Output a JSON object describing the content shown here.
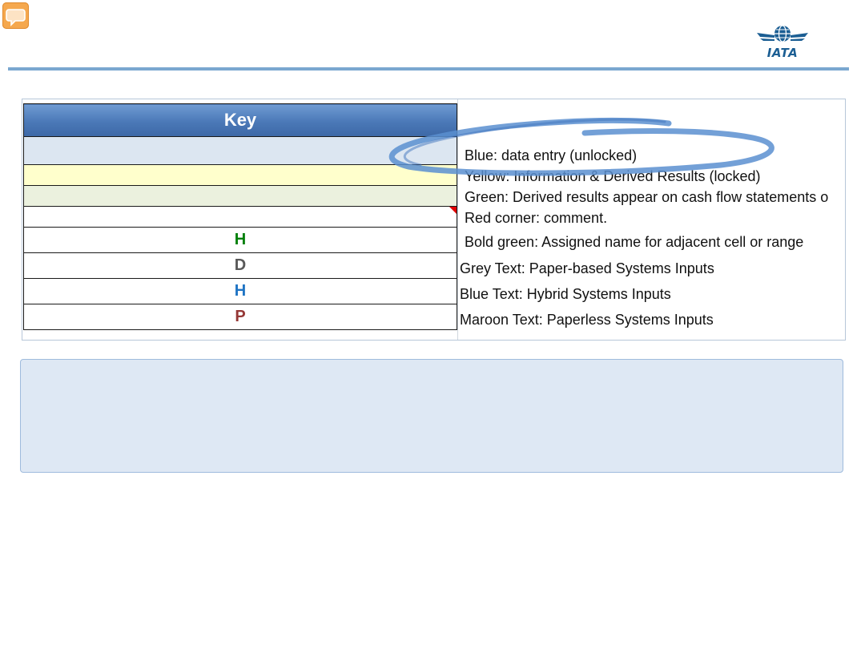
{
  "colors": {
    "header_rule": "#7aa7d0",
    "key_header": "#4a78b7",
    "blue_entry": "#dce6f1",
    "yellow_info": "#ffffcc",
    "green_derived": "#ebf1de",
    "red_corner": "#e00000",
    "bold_green": "#00800a",
    "grey_text": "#595959",
    "blue_text": "#1f74c4",
    "maroon_text": "#953735",
    "note_box": "#dee8f4"
  },
  "icons": {
    "comment": "comment-icon",
    "logo": "iata-logo"
  },
  "logo": {
    "text": "IATA"
  },
  "key": {
    "header": "Key",
    "rows": [
      {
        "swatch": "blue",
        "letter": "",
        "label": "Blue: data entry (unlocked)"
      },
      {
        "swatch": "yellow",
        "letter": "",
        "label": "Yellow: Information & Derived Results (locked)"
      },
      {
        "swatch": "green",
        "letter": "",
        "label": "Green: Derived results appear on cash flow statements o"
      },
      {
        "swatch": "red-corner",
        "letter": "",
        "label": "Red corner: comment."
      },
      {
        "swatch": "none",
        "letter": "H",
        "label": "Bold green: Assigned name for adjacent cell or range"
      },
      {
        "swatch": "none",
        "letter": "D",
        "label": "Grey Text: Paper-based Systems Inputs"
      },
      {
        "swatch": "none",
        "letter": "H",
        "label": "Blue Text: Hybrid Systems Inputs"
      },
      {
        "swatch": "none",
        "letter": "P",
        "label": "Maroon Text: Paperless Systems Inputs"
      }
    ]
  }
}
